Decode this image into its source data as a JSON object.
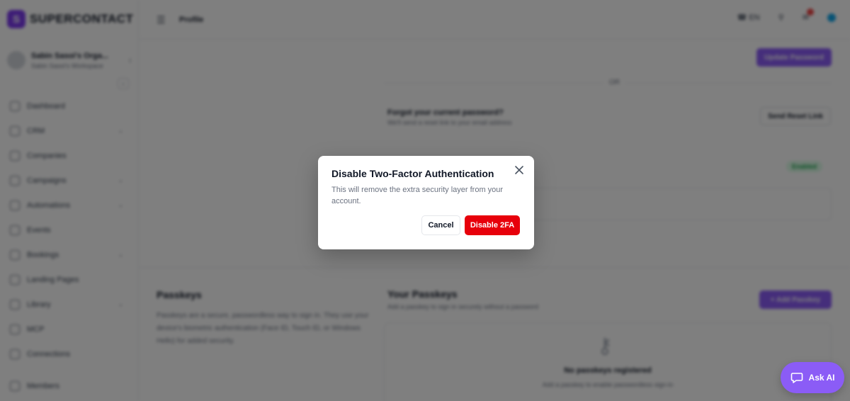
{
  "app": {
    "logo_text": "SUPERCONTACT",
    "org_name": "Sabin Sasoi's Orga...",
    "org_sub": "Sabin Sasoi's Workspace",
    "page_name": "Profile",
    "language": "EN"
  },
  "sidebar": {
    "items": [
      {
        "label": "Dashboard",
        "has_chevron": false
      },
      {
        "label": "CRM",
        "has_chevron": true
      },
      {
        "label": "Companies",
        "has_chevron": false
      },
      {
        "label": "Campaigns",
        "has_chevron": true
      },
      {
        "label": "Automations",
        "has_chevron": true
      },
      {
        "label": "Events",
        "has_chevron": false
      },
      {
        "label": "Bookings",
        "has_chevron": true
      },
      {
        "label": "Landing Pages",
        "has_chevron": false
      },
      {
        "label": "Library",
        "has_chevron": true
      },
      {
        "label": "MCP",
        "has_chevron": false
      },
      {
        "label": "Connections",
        "has_chevron": false
      }
    ],
    "members": "Members"
  },
  "background": {
    "update_password": "Update Password",
    "or": "OR",
    "forgot_title": "Forgot your current password?",
    "forgot_sub": "We'll send a reset link to your email address",
    "send_reset": "Send Reset Link",
    "enabled_badge": "Enabled",
    "passkeys_title": "Passkeys",
    "passkeys_desc": "Passkeys are a secure, passwordless way to sign in. They use your device's biometric authentication (Face ID, Touch ID, or Windows Hello) for added security.",
    "your_passkeys": "Your Passkeys",
    "your_passkeys_sub": "Add a passkey to sign in securely without a password",
    "add_passkey": "+ Add Passkey",
    "no_passkeys": "No passkeys registered",
    "no_passkeys_sub": "Add a passkey to enable passwordless sign-in"
  },
  "modal": {
    "title": "Disable Two-Factor Authentication",
    "description": "This will remove the extra security layer from your account.",
    "cancel_label": "Cancel",
    "confirm_label": "Disable 2FA",
    "confirm_color": "#e7000b"
  },
  "ask_ai": {
    "label": "Ask AI",
    "color": "#8b5cf6"
  }
}
